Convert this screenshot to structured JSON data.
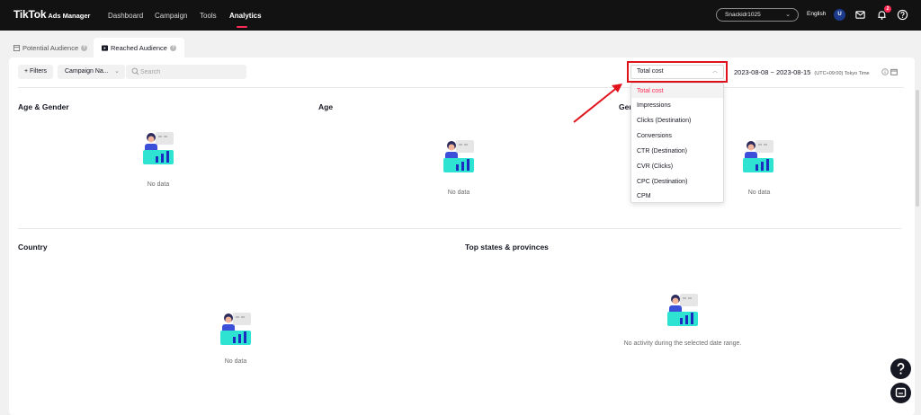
{
  "topbar": {
    "brand": "TikTok",
    "brand_sub": "Ads Manager",
    "nav": [
      {
        "label": "Dashboard",
        "active": false
      },
      {
        "label": "Campaign",
        "active": false
      },
      {
        "label": "Tools",
        "active": false
      },
      {
        "label": "Analytics",
        "active": true
      }
    ],
    "account": "Snackidr1025",
    "language": "English",
    "avatar_initial": "U",
    "notification_count": "2",
    "icons": [
      "mail-icon",
      "bell-icon",
      "help-circle-icon"
    ]
  },
  "tabs": [
    {
      "label": "Potential Audience",
      "icon": "table-icon",
      "active": false
    },
    {
      "label": "Reached Audience",
      "icon": "video-icon",
      "active": true
    }
  ],
  "toolbar": {
    "filters_label": "+ Filters",
    "campaign_label": "Campaign Na...",
    "search_placeholder": "Search",
    "metric_selected": "Total cost",
    "date_start": "2023-08-08",
    "date_sep": "~",
    "date_end": "2023-08-15",
    "timezone": "(UTC+09:00) Tokyo Time"
  },
  "metric_options": [
    "Total cost",
    "Impressions",
    "Clicks (Destination)",
    "Conversions",
    "CTR (Destination)",
    "CVR (Clicks)",
    "CPC (Destination)",
    "CPM"
  ],
  "sections": {
    "age_gender": {
      "title": "Age & Gender",
      "empty": "No data"
    },
    "age": {
      "title": "Age",
      "empty": "No data"
    },
    "gender": {
      "title": "Gen",
      "empty": "No data"
    },
    "country": {
      "title": "Country",
      "empty": "No data"
    },
    "states": {
      "title": "Top states & provinces",
      "empty": "No activity during the selected date range."
    }
  },
  "colors": {
    "accent": "#fe2c55",
    "annotation": "#e0121c",
    "topbar": "#121212"
  }
}
